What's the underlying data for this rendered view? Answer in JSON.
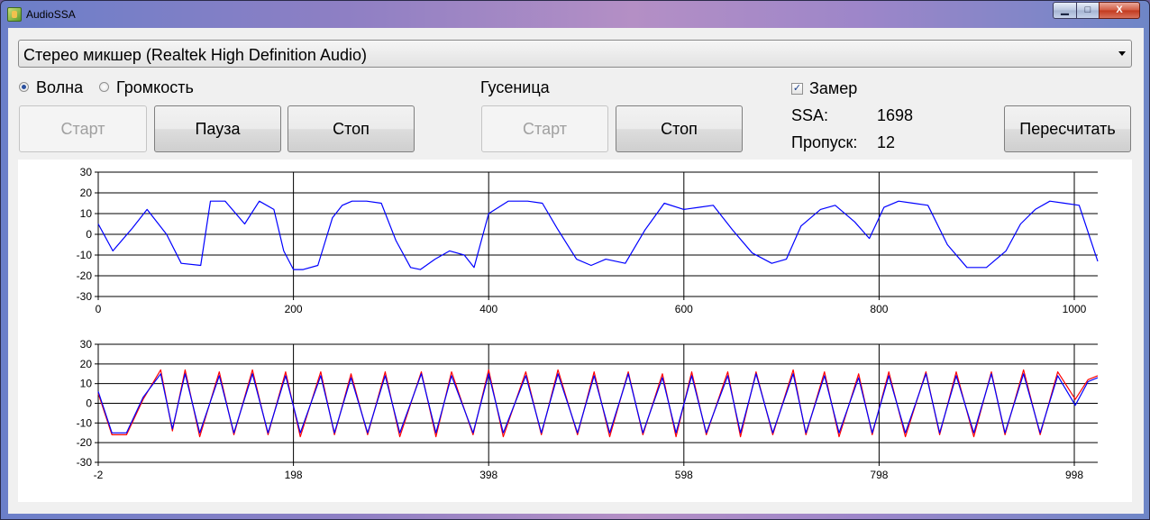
{
  "window": {
    "title": "AudioSSA",
    "min_glyph": "▁",
    "max_glyph": "□",
    "close_glyph": "X"
  },
  "device": {
    "selected": "Стерео микшер (Realtek High Definition Audio)"
  },
  "mode": {
    "options": [
      "Волна",
      "Громкость"
    ],
    "selected": "Волна"
  },
  "buttons": {
    "start": "Старт",
    "pause": "Пауза",
    "stop": "Стоп",
    "track_title": "Гусеница",
    "track_start": "Старт",
    "track_stop": "Стоп",
    "recalc": "Пересчитать"
  },
  "measure": {
    "label": "Замер",
    "checked": true,
    "check_glyph": "✓"
  },
  "stats": {
    "ssa_label": "SSA:",
    "ssa_value": "1698",
    "skip_label": "Пропуск:",
    "skip_value": "12"
  },
  "chart_data": [
    {
      "type": "line",
      "title": "",
      "xlim": [
        0,
        1024
      ],
      "ylim": [
        -30,
        30
      ],
      "xticks": [
        0,
        200,
        400,
        600,
        800,
        1000
      ],
      "yticks": [
        30,
        20,
        10,
        0,
        -10,
        -20,
        -30
      ],
      "grid": true,
      "series": [
        {
          "color": "#0000ff",
          "x": [
            0,
            15,
            35,
            50,
            70,
            85,
            105,
            115,
            130,
            150,
            165,
            180,
            190,
            200,
            210,
            225,
            240,
            250,
            260,
            275,
            290,
            305,
            320,
            330,
            345,
            360,
            375,
            385,
            400,
            420,
            440,
            455,
            470,
            490,
            505,
            520,
            540,
            560,
            580,
            600,
            615,
            630,
            650,
            670,
            690,
            705,
            720,
            740,
            755,
            775,
            790,
            805,
            820,
            835,
            850,
            870,
            890,
            910,
            930,
            945,
            960,
            975,
            990,
            1005,
            1024
          ],
          "y": [
            5,
            -8,
            3,
            12,
            0,
            -14,
            -15,
            16,
            16,
            5,
            16,
            12,
            -8,
            -17,
            -17,
            -15,
            8,
            14,
            16,
            16,
            15,
            -3,
            -16,
            -17,
            -12,
            -8,
            -10,
            -16,
            10,
            16,
            16,
            15,
            3,
            -12,
            -15,
            -12,
            -14,
            2,
            15,
            12,
            13,
            14,
            2,
            -9,
            -14,
            -12,
            4,
            12,
            14,
            6,
            -2,
            13,
            16,
            15,
            14,
            -5,
            -16,
            -16,
            -8,
            5,
            12,
            16,
            15,
            14,
            -13
          ]
        }
      ]
    },
    {
      "type": "line",
      "title": "",
      "xlim": [
        -2,
        1022
      ],
      "ylim": [
        -30,
        30
      ],
      "xticks": [
        -2,
        198,
        398,
        598,
        798,
        998
      ],
      "yticks": [
        30,
        20,
        10,
        0,
        -10,
        -20,
        -30
      ],
      "grid": true,
      "series": [
        {
          "color": "#ff0000",
          "x": [
            -2,
            12,
            27,
            44,
            62,
            74,
            87,
            102,
            122,
            137,
            156,
            172,
            190,
            205,
            226,
            240,
            257,
            274,
            292,
            307,
            329,
            344,
            360,
            382,
            398,
            413,
            436,
            452,
            469,
            489,
            506,
            522,
            541,
            556,
            576,
            590,
            606,
            621,
            643,
            656,
            672,
            689,
            710,
            723,
            742,
            757,
            777,
            791,
            808,
            825,
            846,
            860,
            877,
            895,
            913,
            927,
            946,
            963,
            981,
            999,
            1012,
            1022
          ],
          "y": [
            5,
            -16,
            -16,
            2,
            17,
            -14,
            17,
            -17,
            16,
            -16,
            17,
            -16,
            16,
            -17,
            16,
            -16,
            15,
            -16,
            16,
            -17,
            16,
            -17,
            16,
            -16,
            17,
            -17,
            16,
            -16,
            17,
            -16,
            16,
            -17,
            16,
            -16,
            15,
            -17,
            16,
            -16,
            16,
            -17,
            16,
            -16,
            17,
            -16,
            16,
            -17,
            15,
            -16,
            16,
            -17,
            16,
            -16,
            16,
            -17,
            16,
            -16,
            17,
            -16,
            16,
            2,
            12,
            14
          ]
        },
        {
          "color": "#0000ff",
          "x": [
            -2,
            12,
            27,
            44,
            62,
            74,
            87,
            102,
            122,
            137,
            156,
            172,
            190,
            205,
            226,
            240,
            257,
            274,
            292,
            307,
            329,
            344,
            360,
            382,
            398,
            413,
            436,
            452,
            469,
            489,
            506,
            522,
            541,
            556,
            576,
            590,
            606,
            621,
            643,
            656,
            672,
            689,
            710,
            723,
            742,
            757,
            777,
            791,
            808,
            825,
            846,
            860,
            877,
            895,
            913,
            927,
            946,
            963,
            981,
            999,
            1012,
            1022
          ],
          "y": [
            6,
            -15,
            -15,
            3,
            15,
            -13,
            15,
            -15,
            14,
            -15,
            15,
            -15,
            14,
            -15,
            14,
            -15,
            13,
            -15,
            14,
            -15,
            15,
            -15,
            14,
            -15,
            15,
            -15,
            14,
            -15,
            15,
            -15,
            14,
            -15,
            15,
            -15,
            13,
            -15,
            14,
            -15,
            14,
            -15,
            15,
            -15,
            15,
            -15,
            14,
            -15,
            13,
            -15,
            14,
            -15,
            15,
            -15,
            14,
            -15,
            15,
            -15,
            15,
            -15,
            14,
            -1,
            11,
            13
          ]
        }
      ]
    }
  ]
}
